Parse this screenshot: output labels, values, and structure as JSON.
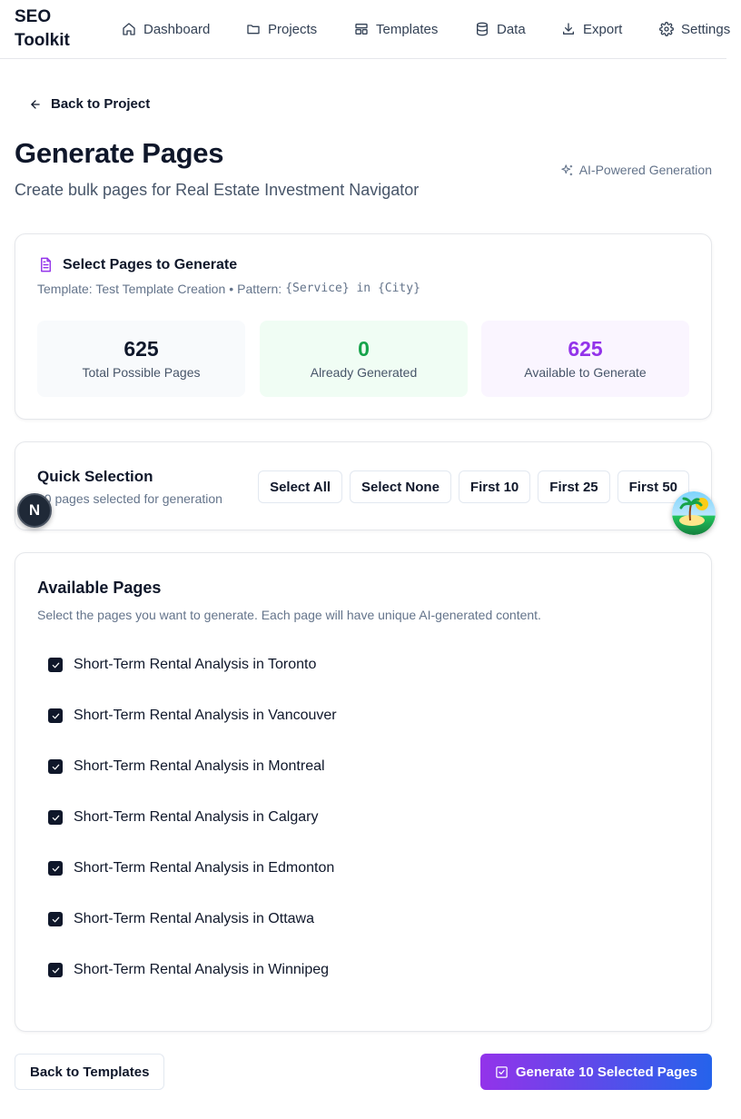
{
  "header": {
    "brand": "SEO Toolkit",
    "nav": [
      {
        "label": "Dashboard",
        "icon": "home-icon"
      },
      {
        "label": "Projects",
        "icon": "folder-icon"
      },
      {
        "label": "Templates",
        "icon": "layout-icon"
      },
      {
        "label": "Data",
        "icon": "database-icon"
      },
      {
        "label": "Export",
        "icon": "download-icon"
      },
      {
        "label": "Settings",
        "icon": "gear-icon"
      }
    ]
  },
  "back_link": "Back to Project",
  "page": {
    "title": "Generate Pages",
    "subtitle": "Create bulk pages for Real Estate Investment Navigator",
    "ai_badge": "AI-Powered Generation"
  },
  "select_card": {
    "title": "Select Pages to Generate",
    "template_text": "Template: Test Template Creation",
    "separator": "•",
    "pattern_label": "Pattern:",
    "pattern": "{Service} in {City}",
    "stats": [
      {
        "value": "625",
        "label": "Total Possible Pages",
        "color": "#0f172a"
      },
      {
        "value": "0",
        "label": "Already Generated",
        "color": "#16a34a"
      },
      {
        "value": "625",
        "label": "Available to Generate",
        "color": "#9333ea"
      }
    ]
  },
  "quick_selection": {
    "title": "Quick Selection",
    "subtitle": "10 pages selected for generation",
    "buttons": [
      "Select All",
      "Select None",
      "First 10",
      "First 25",
      "First 50"
    ]
  },
  "available_pages": {
    "title": "Available Pages",
    "subtitle": "Select the pages you want to generate. Each page will have unique AI-generated content.",
    "pages": [
      {
        "label": "Short-Term Rental Analysis in Toronto",
        "checked": true
      },
      {
        "label": "Short-Term Rental Analysis in Vancouver",
        "checked": true
      },
      {
        "label": "Short-Term Rental Analysis in Montreal",
        "checked": true
      },
      {
        "label": "Short-Term Rental Analysis in Calgary",
        "checked": true
      },
      {
        "label": "Short-Term Rental Analysis in Edmonton",
        "checked": true
      },
      {
        "label": "Short-Term Rental Analysis in Ottawa",
        "checked": true
      },
      {
        "label": "Short-Term Rental Analysis in Winnipeg",
        "checked": true
      }
    ]
  },
  "footer": {
    "back_button": "Back to Templates",
    "generate_button": "Generate 10 Selected Pages"
  },
  "floating": {
    "dev_badge_letter": "N"
  },
  "colors": {
    "accent_purple": "#9333ea",
    "accent_blue": "#2563eb",
    "success_green": "#16a34a"
  }
}
